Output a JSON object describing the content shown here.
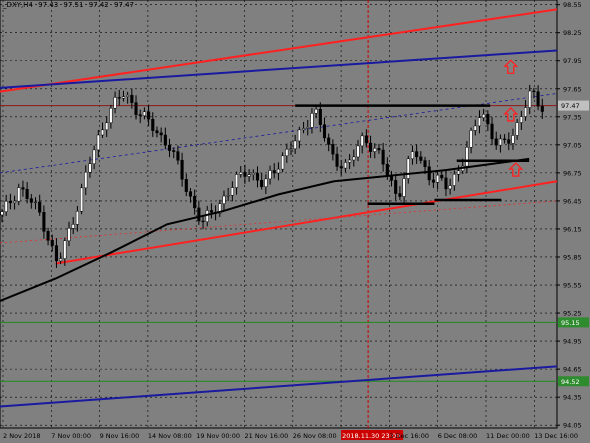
{
  "chart_data": {
    "type": "candlestick",
    "title": "_DXY,H4",
    "ohlc_header": {
      "open": "97.43",
      "high": "97.51",
      "low": "97.42",
      "close": "97.47"
    },
    "y_axis": {
      "ylim": [
        94.02,
        98.6
      ],
      "ticks": [
        "98.55",
        "98.25",
        "97.95",
        "97.65",
        "97.35",
        "97.05",
        "96.75",
        "96.45",
        "96.15",
        "95.85",
        "95.55",
        "95.25",
        "94.95",
        "94.65",
        "94.35",
        "94.05"
      ]
    },
    "x_axis": {
      "labels": [
        "2 Nov 2018",
        "7 Nov 00:00",
        "9 Nov 16:00",
        "14 Nov 08:00",
        "19 Nov 00:00",
        "21 Nov 16:00",
        "26 Nov 08:00",
        "2018.11.30 23:00",
        "3 Dec 16:00",
        "6 Dec 08:00",
        "11 Dec 00:00",
        "13 Dec 16:00"
      ],
      "highlight_label": "2018.11.30 23:00",
      "tick_index": [
        0,
        1,
        2,
        3,
        4,
        5,
        6,
        7,
        8,
        9,
        10,
        11
      ]
    },
    "price_labels": [
      {
        "value": 97.47,
        "text": "97.47",
        "color": "#c0c0c0"
      },
      {
        "value": 95.15,
        "text": "95.15",
        "color": "#2e8b2e"
      },
      {
        "value": 94.52,
        "text": "94.52",
        "color": "#2e8b2e"
      }
    ],
    "horizontal_lines": [
      {
        "value": 97.47,
        "color": "#8b1a1a"
      },
      {
        "value": 95.15,
        "color": "#1e8c1e"
      },
      {
        "value": 94.52,
        "color": "#1e8c1e"
      }
    ],
    "trend_lines": [
      {
        "name": "upper-red",
        "color": "#ff2020",
        "from": [
          0,
          97.62
        ],
        "to": [
          1,
          98.5
        ]
      },
      {
        "name": "upper-blue",
        "color": "#1a1aa0",
        "from": [
          0,
          97.66
        ],
        "to": [
          1,
          98.06
        ]
      },
      {
        "name": "lower-red",
        "color": "#ff2020",
        "from": [
          0.1,
          95.78
        ],
        "to": [
          1,
          96.66
        ]
      },
      {
        "name": "lower-blue",
        "color": "#1a1aa0",
        "from": [
          0,
          94.25
        ],
        "to": [
          1,
          94.68
        ]
      }
    ],
    "support_resistance_segments": [
      {
        "from": [
          0.53,
          97.47
        ],
        "to": [
          0.88,
          97.47
        ]
      },
      {
        "from": [
          0.66,
          96.42
        ],
        "to": [
          0.78,
          96.42
        ]
      },
      {
        "from": [
          0.78,
          96.46
        ],
        "to": [
          0.9,
          96.46
        ]
      },
      {
        "from": [
          0.82,
          96.88
        ],
        "to": [
          0.95,
          96.88
        ]
      }
    ],
    "moving_average": [
      [
        0,
        95.38
      ],
      [
        0.1,
        95.62
      ],
      [
        0.2,
        95.9
      ],
      [
        0.3,
        96.2
      ],
      [
        0.4,
        96.34
      ],
      [
        0.5,
        96.52
      ],
      [
        0.6,
        96.66
      ],
      [
        0.7,
        96.72
      ],
      [
        0.8,
        96.78
      ],
      [
        0.9,
        96.86
      ],
      [
        0.95,
        96.9
      ]
    ],
    "arrows": [
      {
        "x": 0.917,
        "price": 97.88
      },
      {
        "x": 0.917,
        "price": 97.37
      },
      {
        "x": 0.926,
        "price": 96.78
      }
    ]
  }
}
